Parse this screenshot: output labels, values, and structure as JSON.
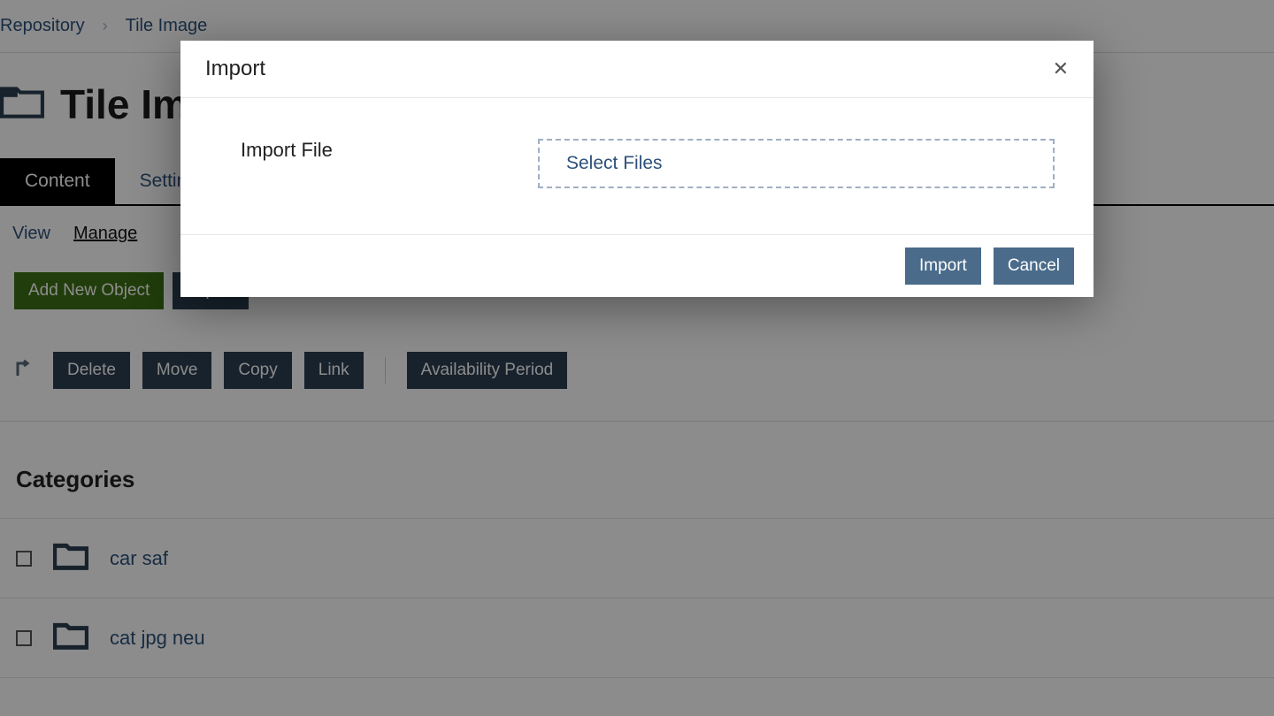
{
  "breadcrumb": {
    "root": "Repository",
    "current": "Tile Image"
  },
  "page": {
    "title": "Tile Image",
    "tabs": {
      "content": "Content",
      "settings": "Settings"
    },
    "subtabs": {
      "view": "View",
      "manage": "Manage"
    },
    "buttons": {
      "addNew": "Add New Object",
      "import": "Import",
      "delete": "Delete",
      "move": "Move",
      "copy": "Copy",
      "link": "Link",
      "availability": "Availability Period"
    },
    "sectionHeading": "Categories",
    "categories": [
      {
        "name": "car saf"
      },
      {
        "name": "cat jpg neu"
      }
    ]
  },
  "dialog": {
    "title": "Import",
    "fieldLabel": "Import File",
    "selectFiles": "Select Files",
    "importBtn": "Import",
    "cancelBtn": "Cancel"
  }
}
